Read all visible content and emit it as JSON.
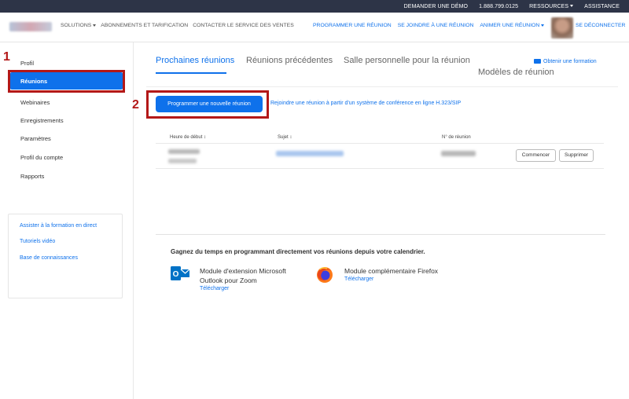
{
  "topbar": {
    "links": [
      "DEMANDER UNE DÉMO",
      "1.888.799.0125",
      "RESSOURCES",
      "ASSISTANCE"
    ]
  },
  "navbar": {
    "left_links": [
      "SOLUTIONS",
      "ABONNEMENTS ET TARIFICATION",
      "CONTACTER LE SERVICE DES VENTES"
    ],
    "right_links": [
      "PROGRAMMER UNE RÉUNION",
      "SE JOINDRE À UNE RÉUNION",
      "ANIMER UNE RÉUNION"
    ],
    "logout": "SE DÉCONNECTER"
  },
  "sidebar": {
    "items": [
      "Profil",
      "Réunions",
      "Webinaires",
      "Enregistrements",
      "Paramètres",
      "Profil du compte",
      "Rapports"
    ],
    "active_index": 1,
    "help": [
      "Assister à la formation en direct",
      "Tutoriels vidéo",
      "Base de connaissances"
    ]
  },
  "annotations": {
    "step1": "1",
    "step2": "2",
    "color": "#b31818"
  },
  "tabs": [
    "Prochaines réunions",
    "Réunions précédentes",
    "Salle personnelle pour la réunion",
    "Modèles de réunion"
  ],
  "training_link": "Obtenir une formation",
  "actions": {
    "schedule": "Programmer une nouvelle réunion",
    "h323": "Rejoindre une réunion à partir d'un système de conférence en ligne H.323/SIP"
  },
  "table": {
    "headers": [
      "Heure de début",
      "Sujet",
      "N° de réunion"
    ],
    "row_buttons": [
      "Commencer",
      "Supprimer"
    ]
  },
  "calendar": {
    "title": "Gagnez du temps en programmant directement vos réunions depuis votre calendrier.",
    "outlook": {
      "line1": "Module d'extension Microsoft",
      "line2": "Outlook pour Zoom",
      "download": "Télécharger"
    },
    "firefox": {
      "line1": "Module complémentaire Firefox",
      "download": "Télécharger"
    }
  },
  "colors": {
    "accent": "#0e71eb",
    "topbar": "#2d3447"
  }
}
